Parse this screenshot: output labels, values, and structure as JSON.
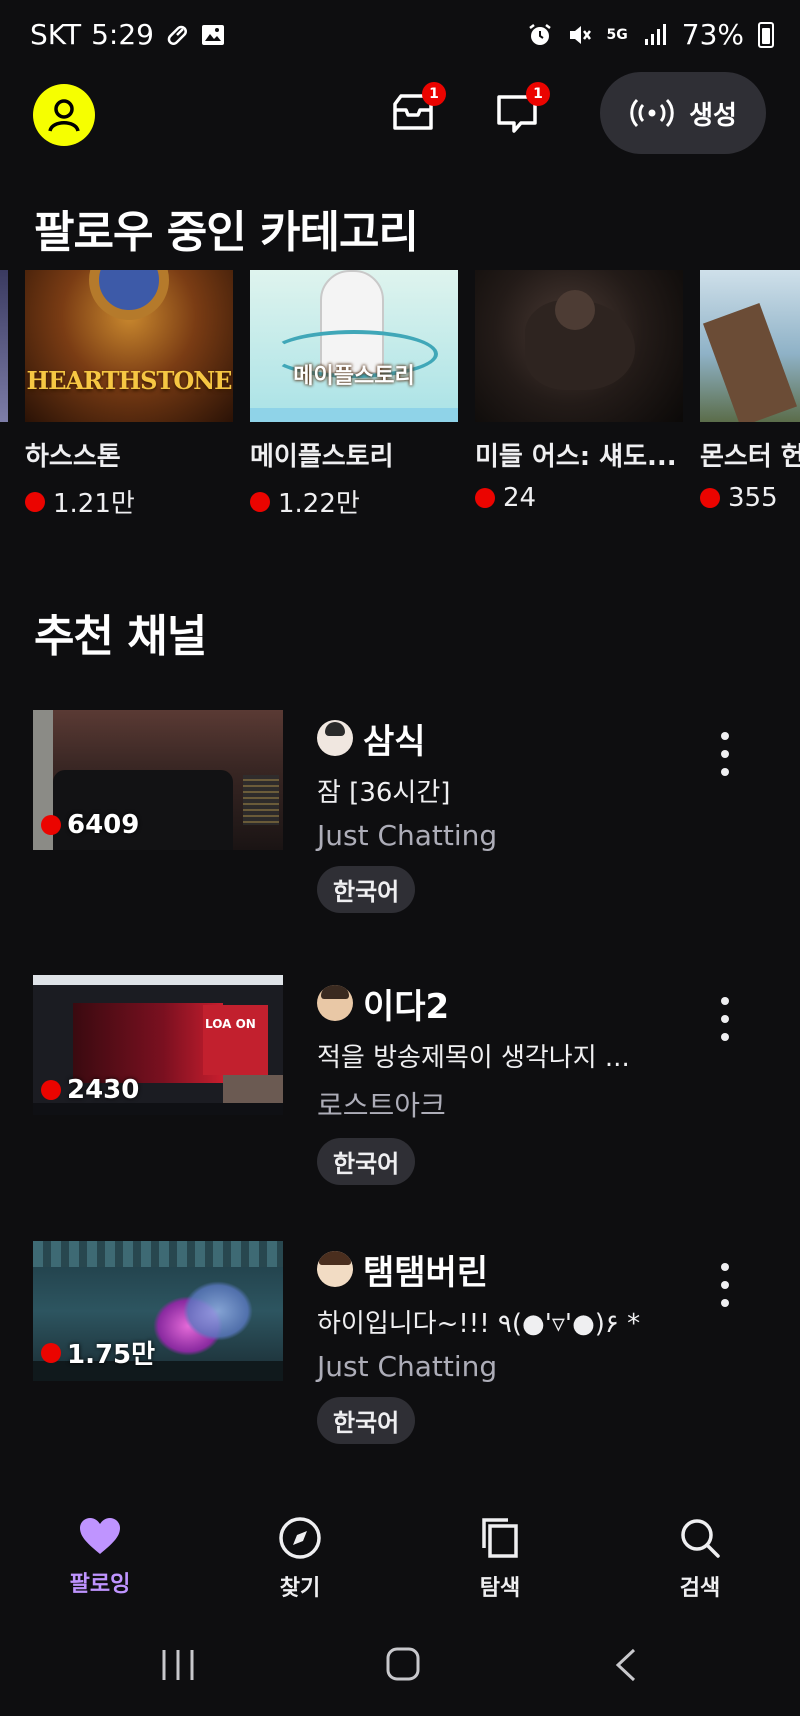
{
  "status_bar": {
    "carrier": "SKT",
    "time": "5:29",
    "network": "5G",
    "battery": "73%"
  },
  "header": {
    "inbox_badge": "1",
    "whisper_badge": "1",
    "create_label": "생성"
  },
  "followed_categories": {
    "title": "팔로우 중인 카테고리",
    "items": [
      {
        "name": "하스스톤",
        "viewers": "1.21만",
        "art_text": "HEARTHSTONE"
      },
      {
        "name": "메이플스토리",
        "viewers": "1.22만",
        "art_text": "메이플스토리"
      },
      {
        "name": "미들 어스: 섀도...",
        "viewers": "24"
      },
      {
        "name": "몬스터 헌",
        "viewers": "355"
      }
    ]
  },
  "recommended": {
    "title": "추천 채널",
    "channels": [
      {
        "name": "삼식",
        "title": "잠 [36시간]",
        "category": "Just Chatting",
        "tag": "한국어",
        "viewers": "6409"
      },
      {
        "name": "이다2",
        "title": "적을 방송제목이 생각나지 ...",
        "category": "로스트아크",
        "tag": "한국어",
        "viewers": "2430",
        "art_text": "LOA ON"
      },
      {
        "name": "탬탬버린",
        "title": "하이입니다~!!! ٩(●'▿'●)۶ *",
        "category": "Just Chatting",
        "tag": "한국어",
        "viewers": "1.75만"
      }
    ]
  },
  "bottom_nav": {
    "items": [
      {
        "label": "팔로잉",
        "icon": "heart-icon",
        "active": true
      },
      {
        "label": "찾기",
        "icon": "compass-icon"
      },
      {
        "label": "탐색",
        "icon": "browse-icon"
      },
      {
        "label": "검색",
        "icon": "search-icon"
      }
    ]
  },
  "colors": {
    "accent": "#bf94ff",
    "live": "#eb0400",
    "avatar": "#f6ff00",
    "background": "#0e0e10"
  }
}
